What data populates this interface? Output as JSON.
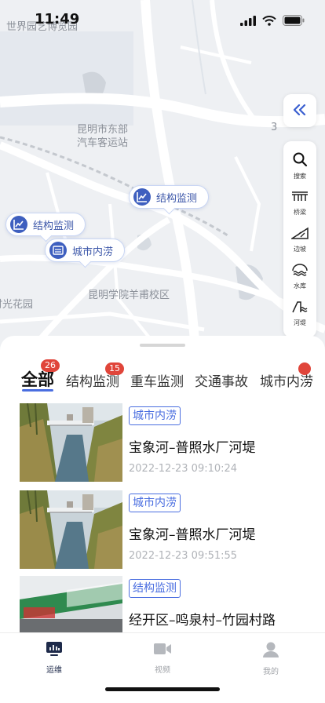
{
  "status_bar": {
    "time": "11:49"
  },
  "map": {
    "labels": {
      "world_expo": "世界园艺博览园",
      "bus_station": "昆明市东部\n汽车客运站",
      "school": "昆明学院羊甫校区",
      "garden": "时光花园",
      "road_num": "3"
    },
    "markers": [
      {
        "label": "结构监测",
        "icon": "chart-line-icon"
      },
      {
        "label": "结构监测",
        "icon": "chart-line-icon"
      },
      {
        "label": "城市内涝",
        "icon": "waterlog-icon"
      }
    ],
    "collapse_icon": "double-chevron-left-icon",
    "tools": [
      {
        "label": "搜索",
        "icon": "search-icon"
      },
      {
        "label": "桥梁",
        "icon": "bridge-icon"
      },
      {
        "label": "边坡",
        "icon": "slope-icon"
      },
      {
        "label": "水库",
        "icon": "reservoir-icon"
      },
      {
        "label": "河堤",
        "icon": "embankment-icon"
      }
    ]
  },
  "tabs": [
    {
      "label": "全部",
      "badge": "26",
      "active": true
    },
    {
      "label": "结构监测",
      "badge": "15"
    },
    {
      "label": "重车监测"
    },
    {
      "label": "交通事故"
    },
    {
      "label": "城市内涝"
    }
  ],
  "items": [
    {
      "tag": "城市内涝",
      "title": "宝象河–普照水厂河堤",
      "time": "2022-12-23 09:10:24"
    },
    {
      "tag": "城市内涝",
      "title": "宝象河–普照水厂河堤",
      "time": "2022-12-23 09:51:55"
    },
    {
      "tag": "结构监测",
      "title": "经开区–鸣泉村–竹园村路"
    }
  ],
  "bottom_nav": [
    {
      "label": "运维",
      "icon": "monitor-chart-icon",
      "active": true
    },
    {
      "label": "视频",
      "icon": "video-icon"
    },
    {
      "label": "我的",
      "icon": "user-icon"
    }
  ],
  "colors": {
    "accent": "#4a6ee0",
    "badge": "#e0453a",
    "marker_icon": "#3e5fbf"
  }
}
